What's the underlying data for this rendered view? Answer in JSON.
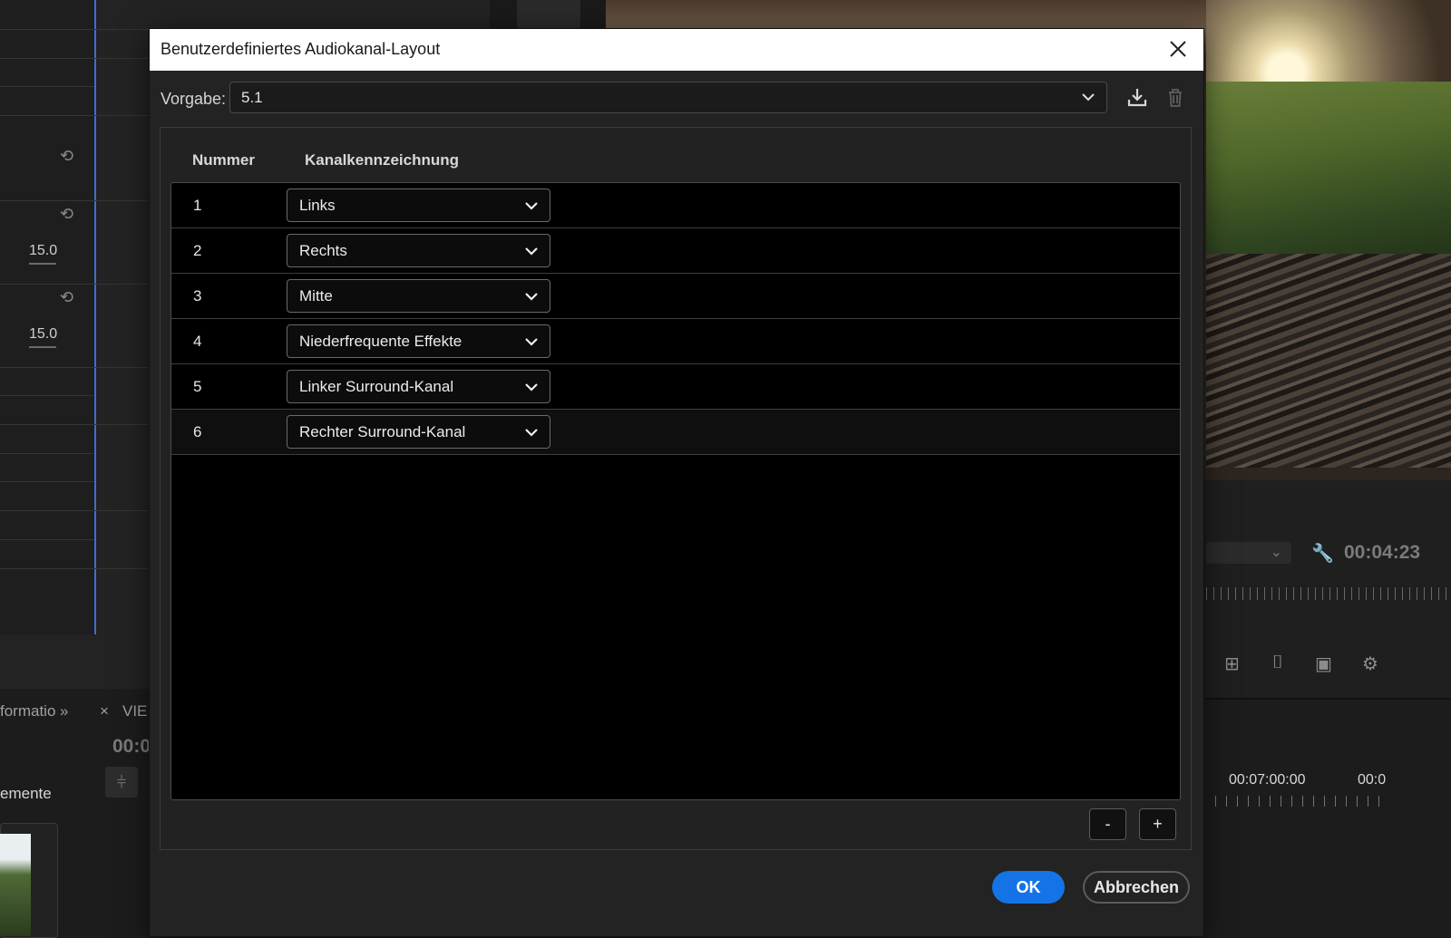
{
  "background": {
    "values": [
      "15.0",
      "15.0"
    ],
    "monitor_timecode": "00:04:23",
    "timeline_times": [
      "00:07:00:00",
      "00:0"
    ],
    "bottom_tabs": [
      "formatio",
      "VIE"
    ],
    "bottom_time": "00:0",
    "elements_label": "emente"
  },
  "dialog": {
    "title": "Benutzerdefiniertes Audiokanal-Layout",
    "preset_label": "Vorgabe:",
    "preset_value": "5.1",
    "columns": [
      "Nummer",
      "Kanalkennzeichnung"
    ],
    "rows": [
      {
        "number": "1",
        "channel": "Links"
      },
      {
        "number": "2",
        "channel": "Rechts"
      },
      {
        "number": "3",
        "channel": "Mitte"
      },
      {
        "number": "4",
        "channel": "Niederfrequente Effekte"
      },
      {
        "number": "5",
        "channel": "Linker Surround-Kanal"
      },
      {
        "number": "6",
        "channel": "Rechter Surround-Kanal"
      }
    ],
    "remove_label": "-",
    "add_label": "+",
    "ok_label": "OK",
    "cancel_label": "Abbrechen"
  },
  "colors": {
    "accent": "#1473e6",
    "dialog_bg": "#232323",
    "table_bg": "#000000"
  }
}
